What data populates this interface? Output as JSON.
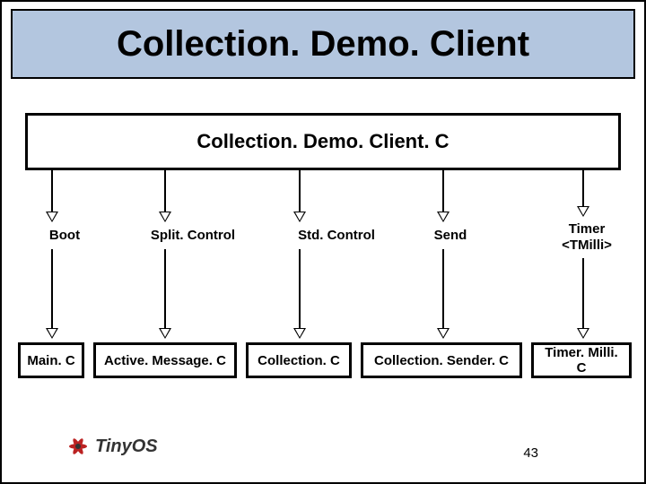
{
  "title": "Collection. Demo. Client",
  "top_component": "Collection. Demo. Client. C",
  "interfaces": {
    "boot": "Boot",
    "split": "Split. Control",
    "std": "Std. Control",
    "send": "Send",
    "timer": "Timer\n<TMilli>"
  },
  "components": {
    "main": "Main. C",
    "activemsg": "Active. Message. C",
    "collection": "Collection. C",
    "sender": "Collection. Sender. C",
    "timermilli": "Timer. Milli. C"
  },
  "page_number": "43",
  "logo_text": "TinyOS"
}
